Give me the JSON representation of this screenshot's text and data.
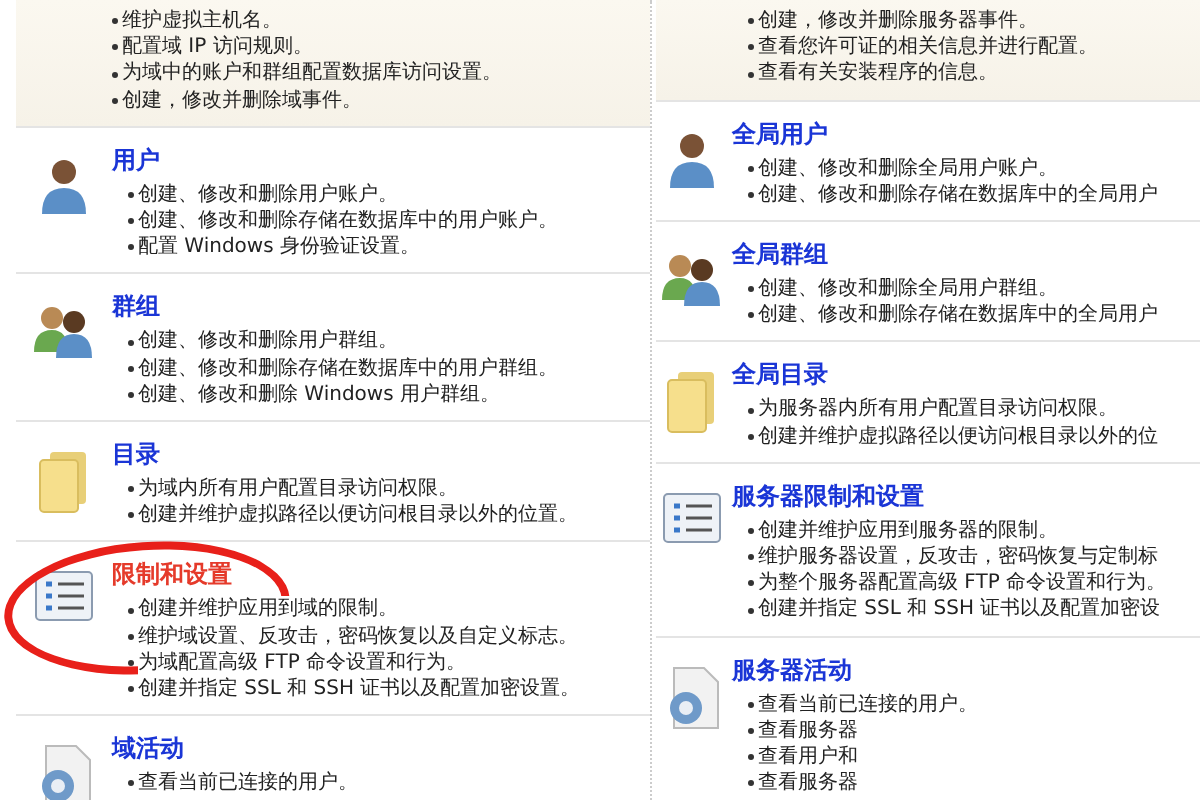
{
  "columns": [
    {
      "top": {
        "lines": [
          "维护虚拟主机名。",
          "配置域 IP 访问规则。",
          "为域中的账户和群组配置数据库访问设置。",
          "创建，修改并删除域事件。"
        ]
      },
      "sections": [
        {
          "title": "用户",
          "kind": "user",
          "circled": false,
          "lines": [
            "创建、修改和删除用户账户。",
            "创建、修改和删除存储在数据库中的用户账户。",
            "配置 Windows 身份验证设置。"
          ]
        },
        {
          "title": "群组",
          "kind": "group",
          "circled": false,
          "lines": [
            "创建、修改和删除用户群组。",
            "创建、修改和删除存储在数据库中的用户群组。",
            "创建、修改和删除 Windows 用户群组。"
          ]
        },
        {
          "title": "目录",
          "kind": "folder",
          "circled": false,
          "lines": [
            "为域内所有用户配置目录访问权限。",
            "创建并维护虚拟路径以便访问根目录以外的位置。"
          ]
        },
        {
          "title": "限制和设置",
          "kind": "list",
          "circled": true,
          "lines": [
            "创建并维护应用到域的限制。",
            "维护域设置、反攻击，密码恢复以及自定义标志。",
            "为域配置高级 FTP 命令设置和行为。",
            "创建并指定 SSL 和 SSH 证书以及配置加密设置。"
          ]
        },
        {
          "title": "域活动",
          "kind": "activity",
          "circled": false,
          "lines": [
            "查看当前已连接的用户。"
          ]
        }
      ]
    },
    {
      "top": {
        "lines": [
          "创建，修改并删除服务器事件。",
          "查看您许可证的相关信息并进行配置。",
          "查看有关安装程序的信息。"
        ]
      },
      "sections": [
        {
          "title": "全局用户",
          "kind": "user",
          "circled": false,
          "lines": [
            "创建、修改和删除全局用户账户。",
            "创建、修改和删除存储在数据库中的全局用户"
          ]
        },
        {
          "title": "全局群组",
          "kind": "group",
          "circled": false,
          "lines": [
            "创建、修改和删除全局用户群组。",
            "创建、修改和删除存储在数据库中的全局用户"
          ]
        },
        {
          "title": "全局目录",
          "kind": "folder",
          "circled": false,
          "lines": [
            "为服务器内所有用户配置目录访问权限。",
            "创建并维护虚拟路径以便访问根目录以外的位"
          ]
        },
        {
          "title": "服务器限制和设置",
          "kind": "list",
          "circled": false,
          "lines": [
            "创建并维护应用到服务器的限制。",
            "维护服务器设置，反攻击，密码恢复与定制标",
            "为整个服务器配置高级 FTP 命令设置和行为。",
            "创建并指定 SSL 和 SSH 证书以及配置加密设"
          ]
        },
        {
          "title": "服务器活动",
          "kind": "activity",
          "circled": false,
          "lines": [
            "查看当前已连接的用户。",
            "查看服务器",
            "查看用户和",
            "查看服务器"
          ]
        }
      ]
    }
  ]
}
